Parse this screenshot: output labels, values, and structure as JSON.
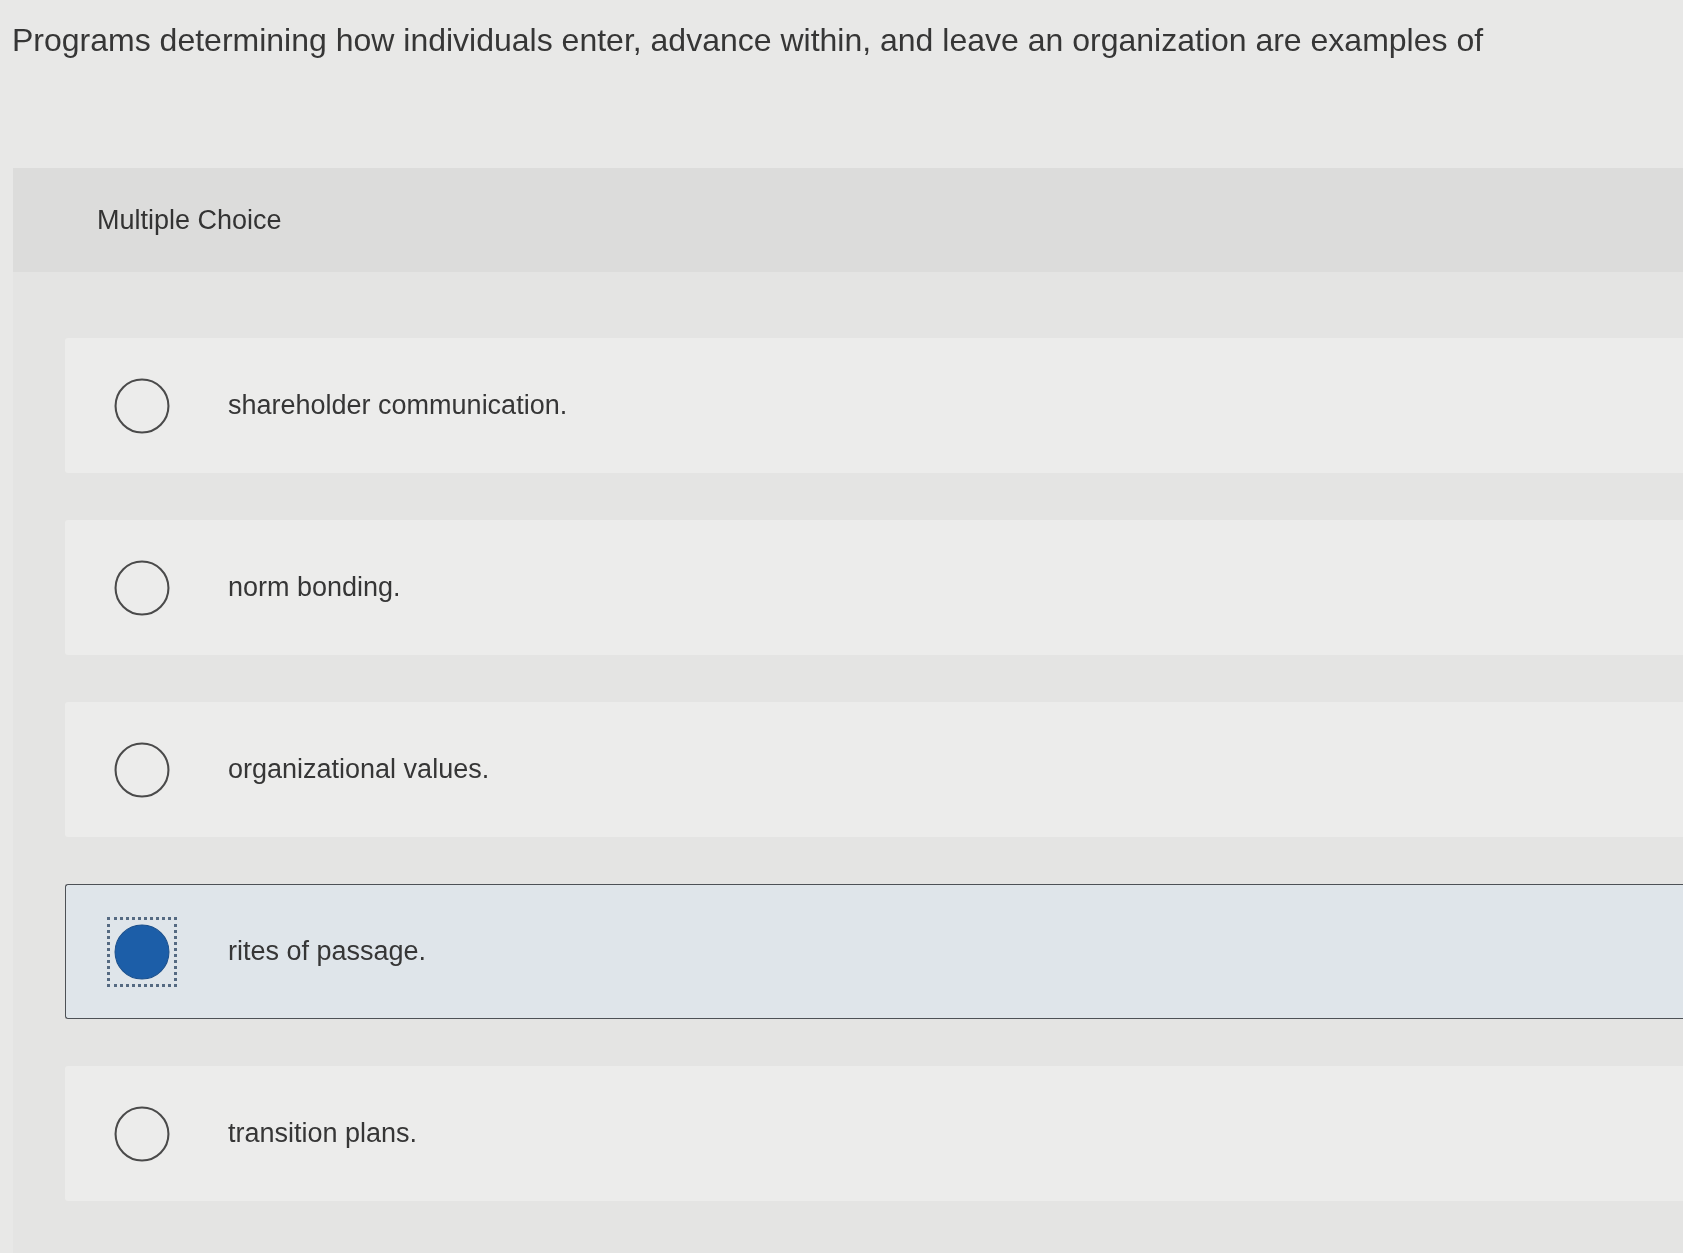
{
  "question": "Programs determining how individuals enter, advance within, and leave an organization are examples of",
  "section_label": "Multiple Choice",
  "options": [
    {
      "text": "shareholder communication.",
      "selected": false
    },
    {
      "text": "norm bonding.",
      "selected": false
    },
    {
      "text": "organizational values.",
      "selected": false
    },
    {
      "text": "rites of passage.",
      "selected": true
    },
    {
      "text": "transition plans.",
      "selected": false
    }
  ]
}
